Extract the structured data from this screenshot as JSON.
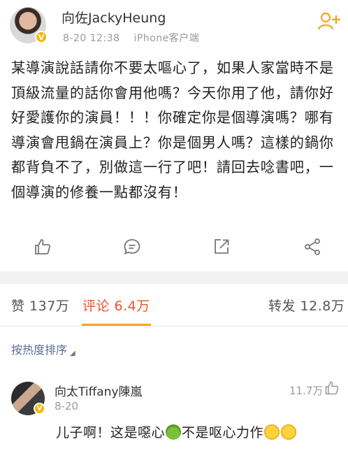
{
  "post": {
    "username": "向佐JackyHeung",
    "verified_badge": "V",
    "time": "8-20 12:38",
    "source": "iPhone客户端",
    "body": "某導演說話請你不要太嘔心了，如果人家當時不是頂級流量的話你會用他嗎？今天你用了他，請你好好愛護你的演員！！！你確定你是個導演嗎？哪有導演會甩鍋在演員上？你是個男人嗎？這樣的鍋你都背負不了，別做這一行了吧！請回去唸書吧，一個導演的修養一點都沒有！"
  },
  "actions": [
    {
      "icon": "thumbs-up-icon"
    },
    {
      "icon": "comment-icon"
    },
    {
      "icon": "repost-icon"
    },
    {
      "icon": "share-icon"
    }
  ],
  "tabs": {
    "likes": "赞 137万",
    "comments": "评论 6.4万",
    "reposts": "转发 12.8万"
  },
  "sort_label": "按热度排序",
  "comment": {
    "username": "向太Tiffany陳嵐",
    "verified_badge": "V",
    "time": "8-20",
    "likes": "11.7万",
    "text_part1": "儿子啊！这是噁心",
    "text_part2": "不是呕心力作"
  },
  "colors": {
    "accent": "#e8562a",
    "tab_underline": "#f5a623",
    "link": "#5a6f99",
    "muted": "#9a9a9a",
    "badge": "#f7b500"
  }
}
